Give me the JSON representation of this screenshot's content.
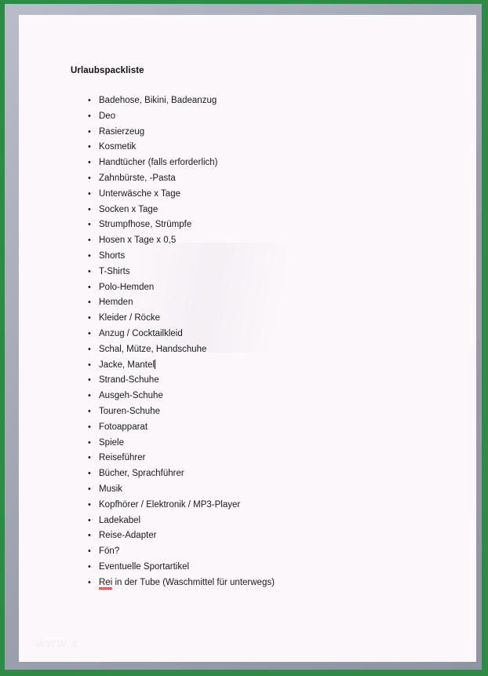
{
  "window": {
    "frame_color": "#2e8b45",
    "bevel_color": "#9aa0ad",
    "page_color": "#fbf7fb"
  },
  "document": {
    "title": "Urlaubspackliste",
    "bullet_glyph": "•",
    "caret_after_item_index": 17,
    "items": [
      {
        "text": "Badehose, Bikini, Badeanzug"
      },
      {
        "text": "Deo"
      },
      {
        "text": "Rasierzeug"
      },
      {
        "text": "Kosmetik"
      },
      {
        "text": "Handtücher (falls erforderlich)"
      },
      {
        "text": "Zahnbürste, -Pasta"
      },
      {
        "text": "Unterwäsche x Tage"
      },
      {
        "text": "Socken x Tage"
      },
      {
        "text": "Strumpfhose, Strümpfe"
      },
      {
        "text": "Hosen x Tage x 0,5"
      },
      {
        "text": "Shorts"
      },
      {
        "text": "T-Shirts"
      },
      {
        "text": "Polo-Hemden"
      },
      {
        "text": "Hemden"
      },
      {
        "text": "Kleider / Röcke"
      },
      {
        "text": "Anzug / Cocktailkleid"
      },
      {
        "text": "Schal, Mütze, Handschuhe"
      },
      {
        "text": "Jacke, Mantel",
        "caret": true
      },
      {
        "text": "Strand-Schuhe"
      },
      {
        "text": "Ausgeh-Schuhe"
      },
      {
        "text": "Touren-Schuhe"
      },
      {
        "text": "Fotoapparat"
      },
      {
        "text": "Spiele"
      },
      {
        "text": "Reiseführer"
      },
      {
        "text": "Bücher, Sprachführer"
      },
      {
        "text": "Musik"
      },
      {
        "text": "Kopfhörer / Elektronik / MP3-Player"
      },
      {
        "text": "Ladekabel"
      },
      {
        "text": "Reise-Adapter"
      },
      {
        "text": "Fön?"
      },
      {
        "text": "Eventuelle Sportartikel"
      },
      {
        "misspelled": "Rei",
        "text": " in der Tube (Waschmittel für unterwegs)",
        "spellcheck_color": "#e02a2a"
      }
    ]
  },
  "watermark": {
    "bottom_text": "www.x"
  }
}
